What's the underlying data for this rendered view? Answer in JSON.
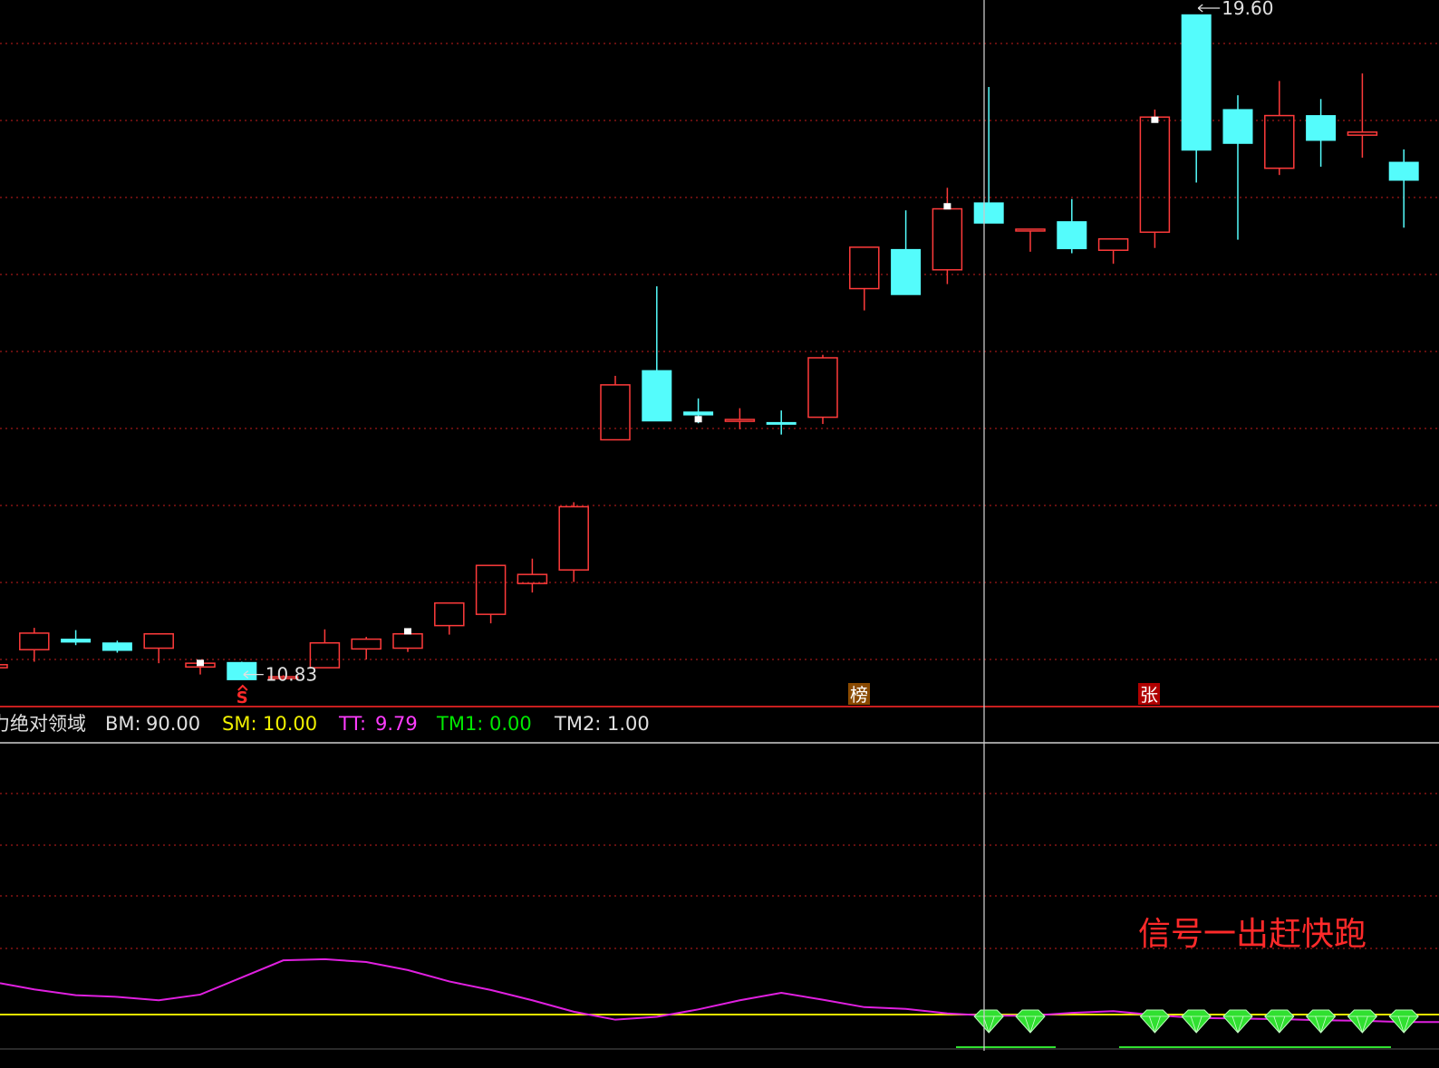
{
  "colors": {
    "background": "#000000",
    "up": "#ff3b3b",
    "down": "#54fcfc",
    "grid": "#a01818",
    "separator": "#c81e1e",
    "crosshair": "#c8c8c8",
    "tt_line": "#e020e0",
    "sm_line": "#e8e800",
    "diamond": "#30e030",
    "text_white": "#e0e0e0",
    "text_yellow": "#f0f000",
    "text_magenta": "#ff3cff",
    "text_green": "#00e800",
    "annotation_red": "#ff2a2a",
    "marker_bang_bg": "#8a4a00",
    "marker_zhang_bg": "#b00000"
  },
  "chart_data": [
    {
      "type": "candlestick",
      "title": "",
      "price_range": [
        10.5,
        19.7
      ],
      "grid": true,
      "candles": [
        {
          "o": 10.92,
          "h": 10.96,
          "l": 10.85,
          "c": 10.96
        },
        {
          "o": 11.16,
          "h": 11.45,
          "l": 11.0,
          "c": 11.38
        },
        {
          "o": 11.3,
          "h": 11.42,
          "l": 11.22,
          "c": 11.26
        },
        {
          "o": 11.25,
          "h": 11.28,
          "l": 11.12,
          "c": 11.15
        },
        {
          "o": 11.18,
          "h": 11.38,
          "l": 10.98,
          "c": 11.37
        },
        {
          "o": 10.93,
          "h": 10.99,
          "l": 10.83,
          "c": 10.98
        },
        {
          "o": 10.99,
          "h": 11.0,
          "l": 10.76,
          "c": 10.76
        },
        {
          "o": 10.78,
          "h": 10.82,
          "l": 10.76,
          "c": 10.8
        },
        {
          "o": 10.92,
          "h": 11.43,
          "l": 10.92,
          "c": 11.25
        },
        {
          "o": 11.17,
          "h": 11.33,
          "l": 11.03,
          "c": 11.3
        },
        {
          "o": 11.18,
          "h": 11.38,
          "l": 11.13,
          "c": 11.37
        },
        {
          "o": 11.48,
          "h": 11.59,
          "l": 11.36,
          "c": 11.78
        },
        {
          "o": 11.63,
          "h": 12.19,
          "l": 11.51,
          "c": 12.28
        },
        {
          "o": 12.04,
          "h": 12.37,
          "l": 11.92,
          "c": 12.16
        },
        {
          "o": 12.22,
          "h": 13.12,
          "l": 12.06,
          "c": 13.06
        },
        {
          "o": 13.95,
          "h": 14.8,
          "l": 14.02,
          "c": 14.68
        },
        {
          "o": 14.87,
          "h": 15.99,
          "l": 14.83,
          "c": 14.2
        },
        {
          "o": 14.32,
          "h": 14.5,
          "l": 14.17,
          "c": 14.28
        },
        {
          "o": 14.2,
          "h": 14.37,
          "l": 14.09,
          "c": 14.22
        },
        {
          "o": 14.18,
          "h": 14.34,
          "l": 14.02,
          "c": 14.16
        },
        {
          "o": 14.25,
          "h": 15.08,
          "l": 14.16,
          "c": 15.04
        },
        {
          "o": 15.96,
          "h": 16.49,
          "l": 15.67,
          "c": 16.51
        },
        {
          "o": 16.48,
          "h": 17.0,
          "l": 15.9,
          "c": 15.88
        },
        {
          "o": 16.21,
          "h": 17.3,
          "l": 16.02,
          "c": 17.02
        },
        {
          "o": 17.1,
          "h": 18.64,
          "l": 16.86,
          "c": 16.83
        },
        {
          "o": 16.75,
          "h": 16.75,
          "l": 16.45,
          "c": 16.75
        },
        {
          "o": 16.85,
          "h": 17.15,
          "l": 16.43,
          "c": 16.49
        },
        {
          "o": 16.47,
          "h": 16.59,
          "l": 16.29,
          "c": 16.62
        },
        {
          "o": 16.71,
          "h": 18.34,
          "l": 16.5,
          "c": 18.24
        },
        {
          "o": 19.6,
          "h": 19.58,
          "l": 17.37,
          "c": 17.8
        },
        {
          "o": 18.34,
          "h": 18.53,
          "l": 16.61,
          "c": 17.89
        },
        {
          "o": 17.56,
          "h": 18.72,
          "l": 17.47,
          "c": 18.26
        },
        {
          "o": 18.26,
          "h": 18.48,
          "l": 17.58,
          "c": 17.93
        },
        {
          "o": 18.0,
          "h": 18.82,
          "l": 17.7,
          "c": 18.04
        },
        {
          "o": 17.64,
          "h": 17.81,
          "l": 16.77,
          "c": 17.4
        }
      ],
      "annotations": {
        "low_label": "10.83",
        "high_label": "19.60",
        "marker_s": "S",
        "marker_bang": "榜",
        "marker_zhang": "张"
      }
    },
    {
      "type": "line",
      "indicator_name": "力绝对领域",
      "readouts": [
        {
          "label": "BM:",
          "value": "90.00",
          "color": "#e0e0e0"
        },
        {
          "label": "SM:",
          "value": "10.00",
          "color": "#f0f000"
        },
        {
          "label": "TT:",
          "value": "9.79",
          "color": "#ff3cff"
        },
        {
          "label": "TM1:",
          "value": "0.00",
          "color": "#00e800"
        },
        {
          "label": "TM2:",
          "value": "1.00",
          "color": "#e0e0e0"
        }
      ],
      "series": [
        {
          "values": [
            15.5,
            14.4,
            13.4,
            13.1,
            12.5,
            13.5,
            16.5,
            19.5,
            19.7,
            19.2,
            17.8,
            15.8,
            14.3,
            12.5,
            10.5,
            9.1,
            9.6,
            10.9,
            12.5,
            13.8,
            12.6,
            11.3,
            11.0,
            10.2,
            9.8,
            9.8,
            10.3,
            10.6,
            9.9,
            9.4,
            9.3,
            9.2,
            9.0,
            8.9,
            8.7
          ]
        },
        {
          "values": [
            10.0,
            10.0,
            10.0,
            10.0,
            10.0,
            10.0,
            10.0,
            10.0,
            10.0,
            10.0,
            10.0,
            10.0,
            10.0,
            10.0,
            10.0,
            10.0,
            10.0,
            10.0,
            10.0,
            10.0,
            10.0,
            10.0,
            10.0,
            10.0,
            10.0,
            10.0,
            10.0,
            10.0,
            10.0,
            10.0,
            10.0,
            10.0,
            10.0,
            10.0,
            10.0
          ]
        }
      ],
      "signal_bars": [
        24,
        25,
        28,
        29,
        30,
        31,
        32,
        33,
        34
      ],
      "annotation": "信号一出赶快跑"
    }
  ]
}
